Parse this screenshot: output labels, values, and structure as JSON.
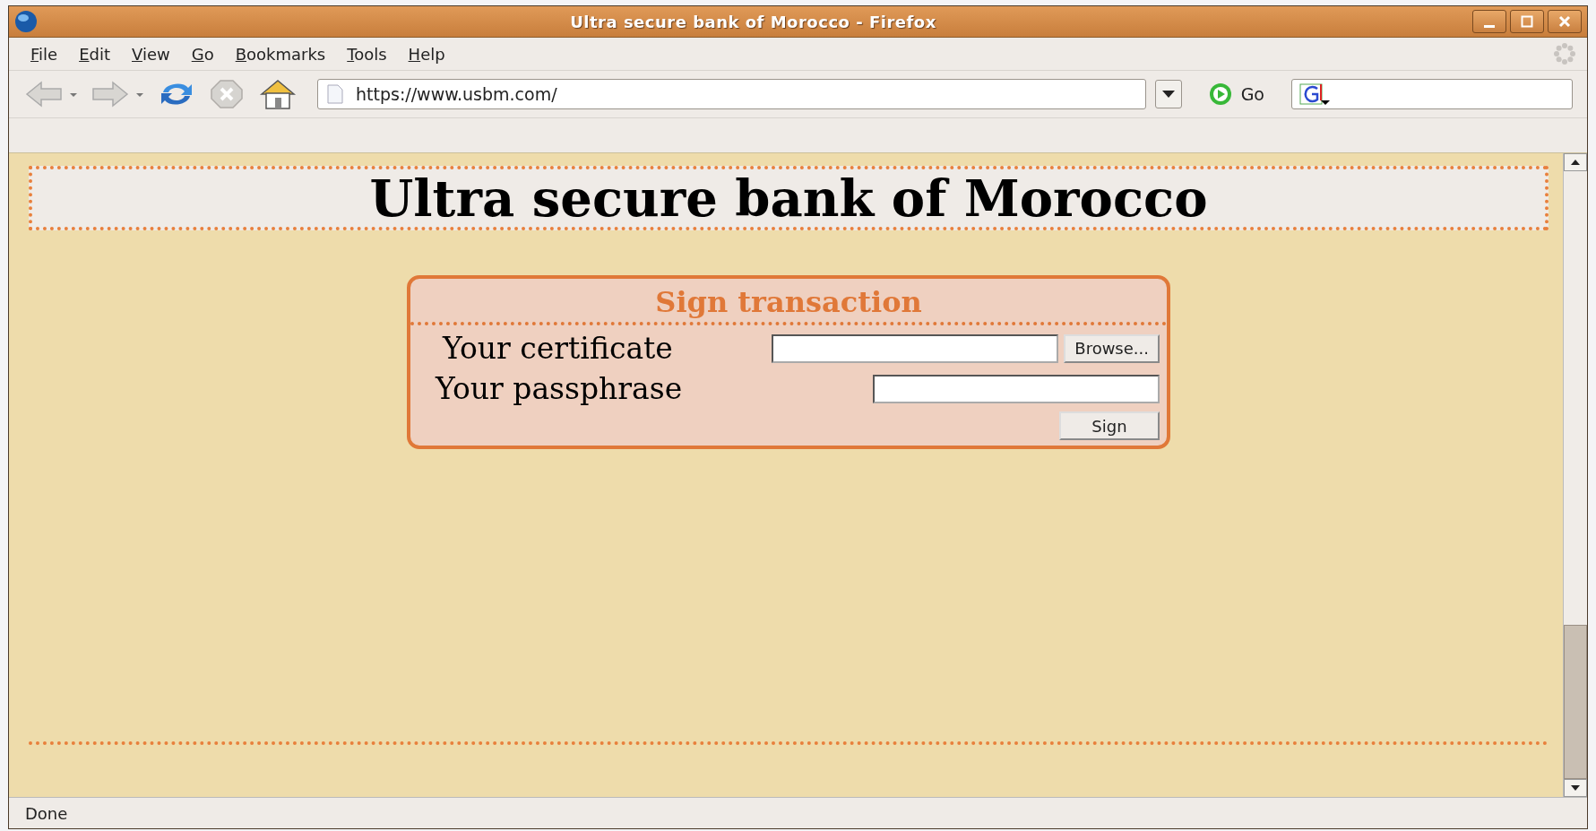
{
  "window": {
    "title": "Ultra secure bank of Morocco - Firefox"
  },
  "menu": [
    "File",
    "Edit",
    "View",
    "Go",
    "Bookmarks",
    "Tools",
    "Help"
  ],
  "toolbar": {
    "url": "https://www.usbm.com/",
    "go_label": "Go"
  },
  "page": {
    "heading": "Ultra secure bank of Morocco",
    "form": {
      "title": "Sign transaction",
      "certificate_label": "Your certificate",
      "browse_label": "Browse...",
      "passphrase_label": "Your passphrase",
      "submit_label": "Sign"
    }
  },
  "status_bar": {
    "text": "Done"
  }
}
